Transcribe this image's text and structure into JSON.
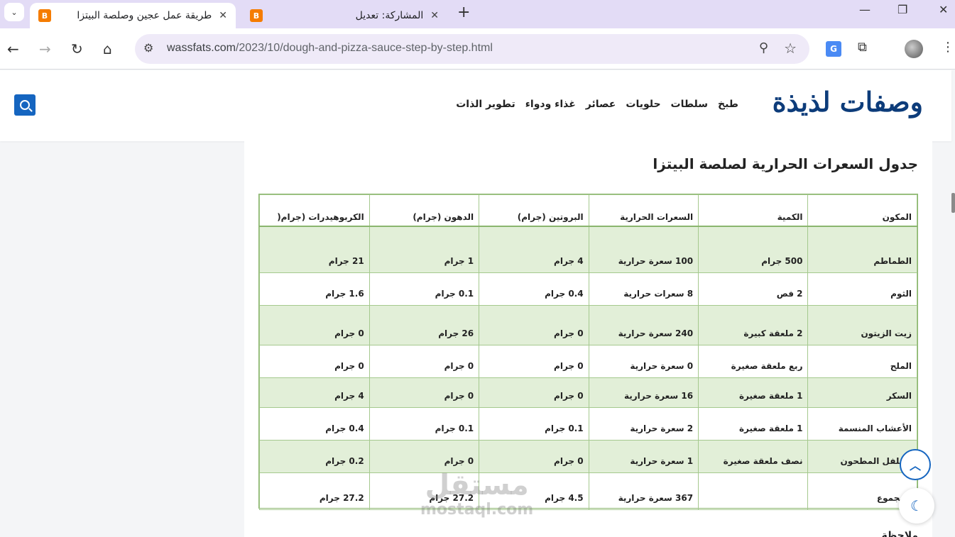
{
  "browser": {
    "tabs": [
      {
        "title": "طريقة عمل عجين وصلصة البيتزا",
        "favicon": "B",
        "active": true
      },
      {
        "title": "المشاركة: تعديل",
        "favicon": "B",
        "active": false
      }
    ],
    "url_host": "wassfats.com",
    "url_path": "/2023/10/dough-and-pizza-sauce-step-by-step.html",
    "translate_label": "G"
  },
  "site": {
    "logo": "وصفات لذيذة",
    "menu": [
      "طبخ",
      "سلطات",
      "حلويات",
      "عصائر",
      "غذاء ودواء",
      "تطوير الذات"
    ]
  },
  "article": {
    "heading": "جدول السعرات الحرارية لصلصة البيتزا",
    "table": {
      "headers": [
        "المكون",
        "الكمية",
        "السعرات الحرارية",
        "البروتين (جرام)",
        "الدهون (جرام)",
        "الكربوهيدرات (جرام("
      ],
      "rows": [
        [
          "الطماطم",
          "500 جرام",
          "100 سعرة حرارية",
          "4 جرام",
          "1 جرام",
          "21 جرام"
        ],
        [
          "الثوم",
          "2 فص",
          "8 سعرات حرارية",
          "0.4 جرام",
          "0.1 جرام",
          "1.6 جرام"
        ],
        [
          "زيت الزيتون",
          "2 ملعقة كبيرة",
          "240 سعرة حرارية",
          "0 جرام",
          "26 جرام",
          "0 جرام"
        ],
        [
          "الملح",
          "ربع ملعقة صغيرة",
          "0 سعرة حرارية",
          "0 جرام",
          "0 جرام",
          "0 جرام"
        ],
        [
          "السكر",
          "1 ملعقة صغيرة",
          "16 سعرة حرارية",
          "0 جرام",
          "0 جرام",
          "4 جرام"
        ],
        [
          "الأعشاب المنسمة",
          "1 ملعقة صغيرة",
          "2 سعرة حرارية",
          "0.1 جرام",
          "0.1 جرام",
          "0.4 جرام"
        ],
        [
          "الفلفل المطحون",
          "نصف ملعقة صغيرة",
          "1 سعرة حرارية",
          "0 جرام",
          "0 جرام",
          "0.2 جرام"
        ],
        [
          "المجموع",
          "",
          "367 سعرة حرارية",
          "4.5 جرام",
          "27.2 جرام",
          "27.2 جرام"
        ]
      ]
    },
    "next_heading": "ملاحظة"
  },
  "watermark": {
    "arabic": "مستقل",
    "latin": "mostaql.com"
  },
  "colors": {
    "accent": "#1565c0",
    "row_shade": "#e2efd8",
    "table_border": "#8bb56e",
    "logo": "#0d3c7a"
  }
}
